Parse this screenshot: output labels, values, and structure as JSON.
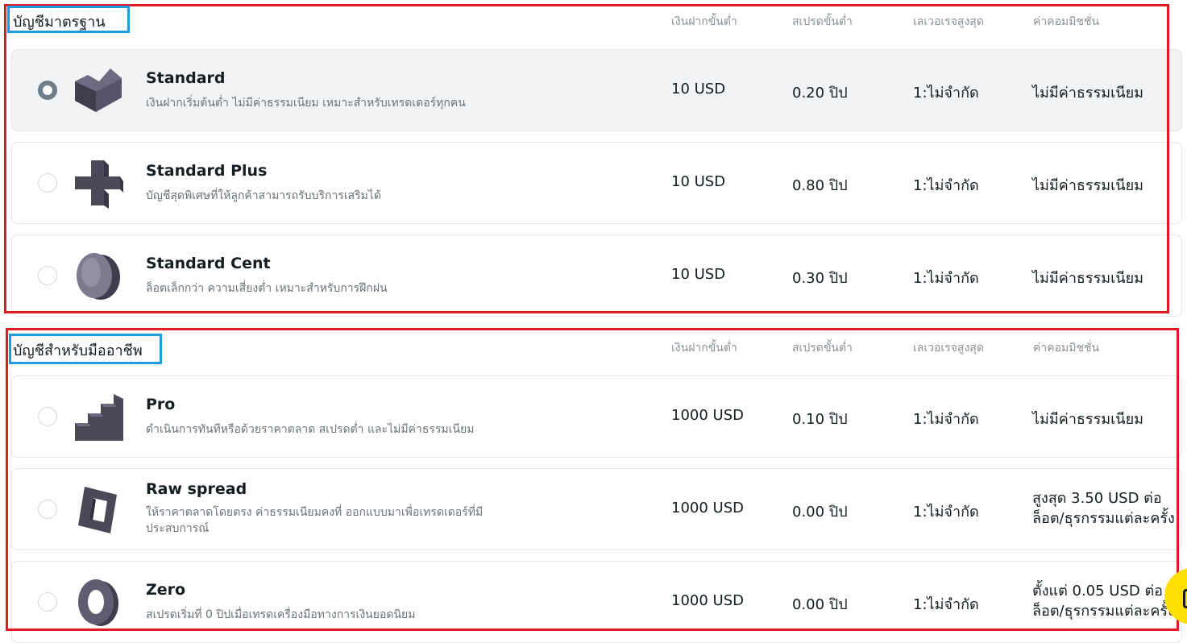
{
  "columns": {
    "min_deposit": "เงินฝากขั้นต่ำ",
    "min_spread": "สเปรดขั้นต่ำ",
    "max_leverage": "เลเวอเรจสูงสุด",
    "commission": "ค่าคอมมิชชั่น"
  },
  "sections": [
    {
      "title": "บัญชีมาตรฐาน",
      "accounts": [
        {
          "name": "Standard",
          "desc": "เงินฝากเริ่มต้นต่ำ ไม่มีค่าธรรมเนียม เหมาะสำหรับเทรดเดอร์ทุกคน",
          "min_deposit": "10 USD",
          "spread": "0.20 ปิป",
          "leverage": "1:ไม่จำกัด",
          "commission": "ไม่มีค่าธรรมเนียม",
          "selected": true,
          "icon": "chevron-block-icon"
        },
        {
          "name": "Standard Plus",
          "desc": "บัญชีสุดพิเศษที่ให้ลูกค้าสามารถรับบริการเสริมได้",
          "min_deposit": "10 USD",
          "spread": "0.80 ปิป",
          "leverage": "1:ไม่จำกัด",
          "commission": "ไม่มีค่าธรรมเนียม",
          "selected": false,
          "icon": "cross-block-icon"
        },
        {
          "name": "Standard Cent",
          "desc": "ล็อตเล็กกว่า ความเสี่ยงต่ำ เหมาะสำหรับการฝึกฝน",
          "min_deposit": "10 USD",
          "spread": "0.30 ปิป",
          "leverage": "1:ไม่จำกัด",
          "commission": "ไม่มีค่าธรรมเนียม",
          "selected": false,
          "icon": "disc-block-icon"
        }
      ]
    },
    {
      "title": "บัญชีสำหรับมืออาชีพ",
      "accounts": [
        {
          "name": "Pro",
          "desc": "ดำเนินการทันทีหรือด้วยราคาตลาด สเปรดต่ำ และไม่มีค่าธรรมเนียม",
          "min_deposit": "1000 USD",
          "spread": "0.10 ปิป",
          "leverage": "1:ไม่จำกัด",
          "commission": "ไม่มีค่าธรรมเนียม",
          "selected": false,
          "icon": "stairs-block-icon"
        },
        {
          "name": "Raw spread",
          "desc": "ให้ราคาตลาดโดยตรง ค่าธรรมเนียมคงที่ ออกแบบมาเพื่อเทรดเดอร์ที่มีประสบการณ์",
          "min_deposit": "1000 USD",
          "spread": "0.00 ปิป",
          "leverage": "1:ไม่จำกัด",
          "commission": "สูงสุด 3.50 USD ต่อล็อต/ธุรกรรมแต่ละครั้ง",
          "selected": false,
          "icon": "frame-block-icon"
        },
        {
          "name": "Zero",
          "desc": "สเปรดเริ่มที่ 0 ปิปเมื่อเทรดเครื่องมือทางการเงินยอดนิยม",
          "min_deposit": "1000 USD",
          "spread": "0.00 ปิป",
          "leverage": "1:ไม่จำกัด",
          "commission": "ตั้งแต่ 0.05 USD ต่อล็อต/ธุรกรรมแต่ละครั้ง",
          "selected": false,
          "icon": "ring-block-icon"
        }
      ]
    }
  ],
  "colors": {
    "annotation_red": "#e01b24",
    "annotation_blue": "#1e9be0",
    "radio_checked": "#6f7d88",
    "icon_fill": "#4a4958",
    "chat_button": "#ffde02"
  }
}
